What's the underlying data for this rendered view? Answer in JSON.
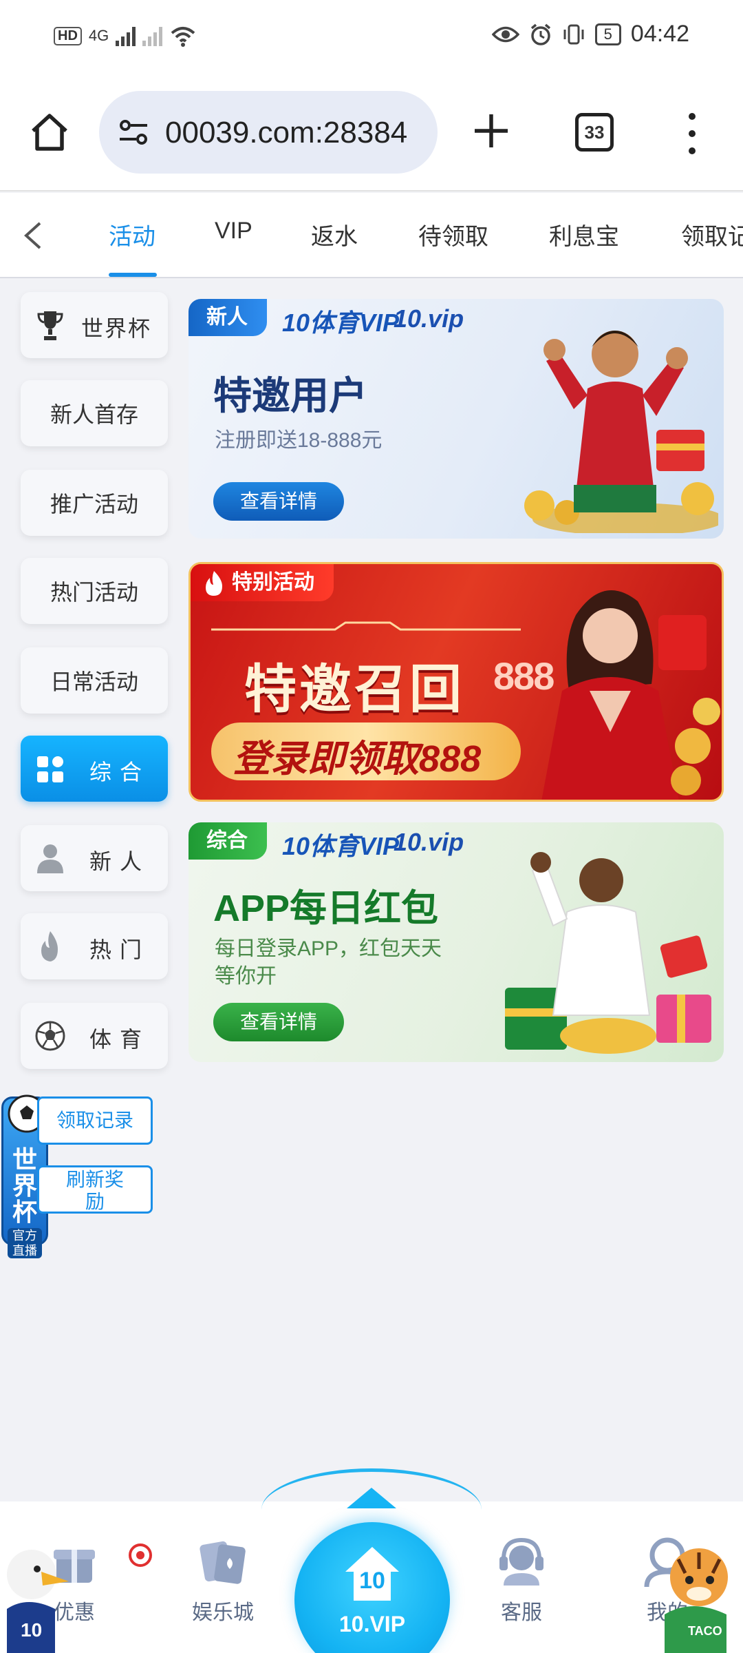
{
  "status_bar": {
    "network_hd": "HD",
    "network_4g": "4G",
    "battery": "5",
    "time": "04:42"
  },
  "browser": {
    "url": "00039.com:28384",
    "tab_count": "33"
  },
  "top_tabs": [
    {
      "label": "活动",
      "active": true
    },
    {
      "label": "VIP"
    },
    {
      "label": "返水"
    },
    {
      "label": "待领取"
    },
    {
      "label": "利息宝"
    },
    {
      "label": "领取记"
    }
  ],
  "side_menu": [
    {
      "label": "世界杯",
      "icon": "trophy-icon"
    },
    {
      "label": "新人首存"
    },
    {
      "label": "推广活动"
    },
    {
      "label": "热门活动"
    },
    {
      "label": "日常活动"
    },
    {
      "label": "综合",
      "icon": "grid-icon",
      "active": true
    },
    {
      "label": "新人",
      "icon": "person-icon"
    },
    {
      "label": "热门",
      "icon": "flame-icon"
    },
    {
      "label": "体育",
      "icon": "soccer-ball-icon"
    }
  ],
  "banners": [
    {
      "tag": "新人",
      "brand_a": "10体育VIP",
      "brand_b": "10.vip",
      "title": "特邀用户",
      "subtitle": "注册即送18-888元",
      "button": "查看详情"
    },
    {
      "tag": "特别活动",
      "title": "特邀召回",
      "subtitle": "登录即领取888",
      "badge": "888"
    },
    {
      "tag": "综合",
      "brand_a": "10体育VIP",
      "brand_b": "10.vip",
      "title": "APP每日红包",
      "subtitle_line1": "每日登录APP，红包天天",
      "subtitle_line2": "等你开",
      "button": "查看详情"
    }
  ],
  "floating": {
    "badge_title": "世界杯",
    "badge_sub": "官方直播",
    "claim_records": "领取记录",
    "refresh_line1": "刷新奖",
    "refresh_line2": "励"
  },
  "bottom_nav": {
    "promos": "优惠",
    "casino": "娱乐城",
    "center_top": "10",
    "center_label": "10.VIP",
    "support": "客服",
    "mine": "我的"
  },
  "colors": {
    "accent": "#1a8fe8",
    "page_bg": "#f1f2f6",
    "green_button": "#2a9a2a",
    "blue_button": "#1470c8"
  }
}
